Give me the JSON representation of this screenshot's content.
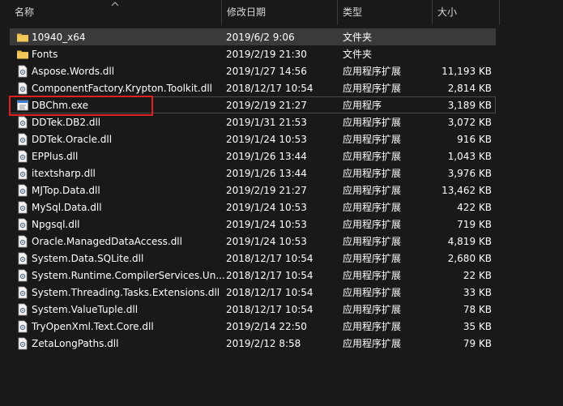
{
  "columns": {
    "name": "名称",
    "date": "修改日期",
    "type": "类型",
    "size": "大小"
  },
  "colors": {
    "background": "#191919",
    "selected_row": "#3a3a3a",
    "folder_icon": "#e8b64a",
    "highlight": "#e02020"
  },
  "files": [
    {
      "name": "10940_x64",
      "date": "2019/6/2 9:06",
      "type": "文件夹",
      "size": "",
      "icon": "folder-icon"
    },
    {
      "name": "Fonts",
      "date": "2019/2/19 21:30",
      "type": "文件夹",
      "size": "",
      "icon": "folder-icon"
    },
    {
      "name": "Aspose.Words.dll",
      "date": "2019/1/27 14:56",
      "type": "应用程序扩展",
      "size": "11,193 KB",
      "icon": "dll-icon"
    },
    {
      "name": "ComponentFactory.Krypton.Toolkit.dll",
      "date": "2018/12/17 10:54",
      "type": "应用程序扩展",
      "size": "2,814 KB",
      "icon": "dll-icon"
    },
    {
      "name": "DBChm.exe",
      "date": "2019/2/19 21:27",
      "type": "应用程序",
      "size": "3,189 KB",
      "icon": "exe-icon"
    },
    {
      "name": "DDTek.DB2.dll",
      "date": "2019/1/31 21:53",
      "type": "应用程序扩展",
      "size": "3,072 KB",
      "icon": "dll-icon"
    },
    {
      "name": "DDTek.Oracle.dll",
      "date": "2019/1/24 10:53",
      "type": "应用程序扩展",
      "size": "916 KB",
      "icon": "dll-icon"
    },
    {
      "name": "EPPlus.dll",
      "date": "2019/1/26 13:44",
      "type": "应用程序扩展",
      "size": "1,043 KB",
      "icon": "dll-icon"
    },
    {
      "name": "itextsharp.dll",
      "date": "2019/1/26 13:44",
      "type": "应用程序扩展",
      "size": "3,976 KB",
      "icon": "dll-icon"
    },
    {
      "name": "MJTop.Data.dll",
      "date": "2019/2/19 21:27",
      "type": "应用程序扩展",
      "size": "13,462 KB",
      "icon": "dll-icon"
    },
    {
      "name": "MySql.Data.dll",
      "date": "2019/1/24 10:53",
      "type": "应用程序扩展",
      "size": "422 KB",
      "icon": "dll-icon"
    },
    {
      "name": "Npgsql.dll",
      "date": "2019/1/24 10:53",
      "type": "应用程序扩展",
      "size": "719 KB",
      "icon": "dll-icon"
    },
    {
      "name": "Oracle.ManagedDataAccess.dll",
      "date": "2019/1/24 10:53",
      "type": "应用程序扩展",
      "size": "4,819 KB",
      "icon": "dll-icon"
    },
    {
      "name": "System.Data.SQLite.dll",
      "date": "2018/12/17 10:54",
      "type": "应用程序扩展",
      "size": "2,680 KB",
      "icon": "dll-icon"
    },
    {
      "name": "System.Runtime.CompilerServices.Un...",
      "date": "2018/12/17 10:54",
      "type": "应用程序扩展",
      "size": "22 KB",
      "icon": "dll-icon"
    },
    {
      "name": "System.Threading.Tasks.Extensions.dll",
      "date": "2018/12/17 10:54",
      "type": "应用程序扩展",
      "size": "33 KB",
      "icon": "dll-icon"
    },
    {
      "name": "System.ValueTuple.dll",
      "date": "2018/12/17 10:54",
      "type": "应用程序扩展",
      "size": "78 KB",
      "icon": "dll-icon"
    },
    {
      "name": "TryOpenXml.Text.Core.dll",
      "date": "2019/2/14 22:50",
      "type": "应用程序扩展",
      "size": "35 KB",
      "icon": "dll-icon"
    },
    {
      "name": "ZetaLongPaths.dll",
      "date": "2019/2/12 8:58",
      "type": "应用程序扩展",
      "size": "79 KB",
      "icon": "dll-icon"
    }
  ]
}
